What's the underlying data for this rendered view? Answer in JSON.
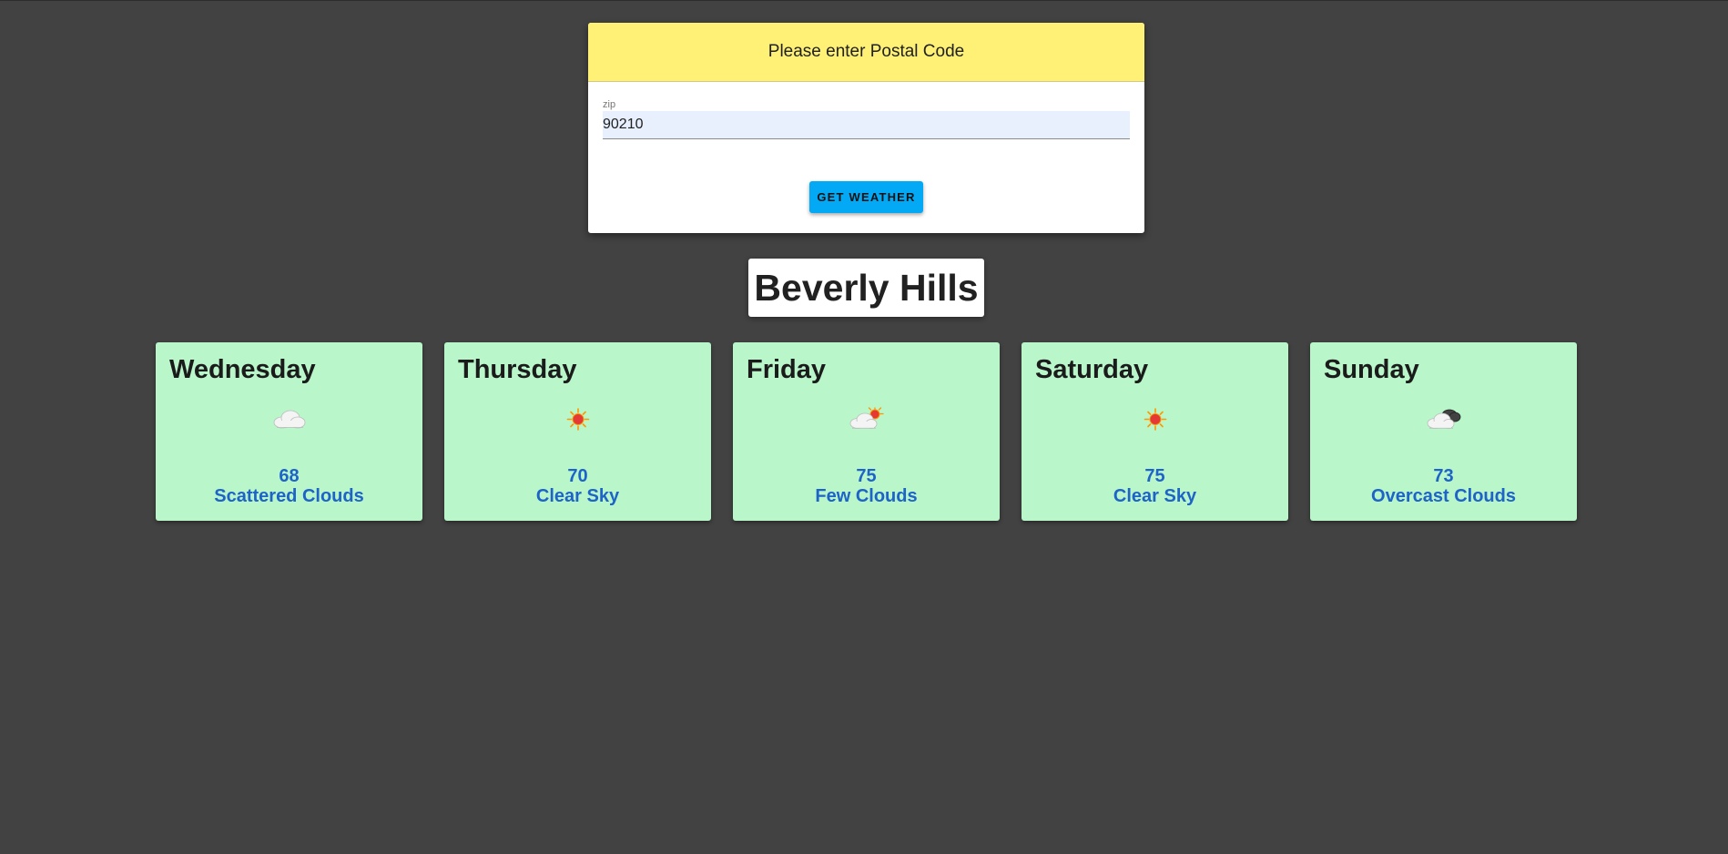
{
  "form": {
    "header": "Please enter Postal Code",
    "field_label": "zip",
    "field_value": "90210",
    "button_label": "GET WEATHER"
  },
  "city": "Beverly Hills",
  "forecast": [
    {
      "day": "Wednesday",
      "temp": "68",
      "description": "Scattered Clouds",
      "icon": "scattered-clouds-icon"
    },
    {
      "day": "Thursday",
      "temp": "70",
      "description": "Clear Sky",
      "icon": "sun-icon"
    },
    {
      "day": "Friday",
      "temp": "75",
      "description": "Few Clouds",
      "icon": "few-clouds-icon"
    },
    {
      "day": "Saturday",
      "temp": "75",
      "description": "Clear Sky",
      "icon": "sun-icon"
    },
    {
      "day": "Sunday",
      "temp": "73",
      "description": "Overcast Clouds",
      "icon": "overcast-clouds-icon"
    }
  ],
  "colors": {
    "background": "#424242",
    "header_yellow": "#fff176",
    "button_blue": "#03a9f4",
    "card_green": "#b9f6ca",
    "forecast_text_blue": "#1e63c8"
  }
}
